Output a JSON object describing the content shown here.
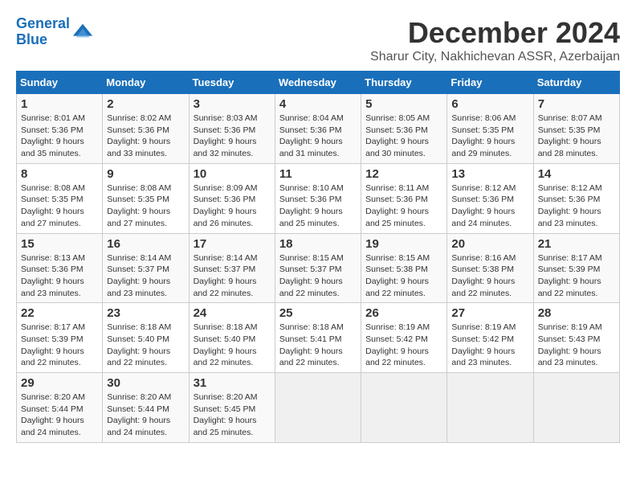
{
  "logo": {
    "line1": "General",
    "line2": "Blue"
  },
  "title": "December 2024",
  "subtitle": "Sharur City, Nakhichevan ASSR, Azerbaijan",
  "header_row": [
    "Sunday",
    "Monday",
    "Tuesday",
    "Wednesday",
    "Thursday",
    "Friday",
    "Saturday"
  ],
  "weeks": [
    [
      {
        "day": "1",
        "sunrise": "Sunrise: 8:01 AM",
        "sunset": "Sunset: 5:36 PM",
        "daylight": "Daylight: 9 hours and 35 minutes."
      },
      {
        "day": "2",
        "sunrise": "Sunrise: 8:02 AM",
        "sunset": "Sunset: 5:36 PM",
        "daylight": "Daylight: 9 hours and 33 minutes."
      },
      {
        "day": "3",
        "sunrise": "Sunrise: 8:03 AM",
        "sunset": "Sunset: 5:36 PM",
        "daylight": "Daylight: 9 hours and 32 minutes."
      },
      {
        "day": "4",
        "sunrise": "Sunrise: 8:04 AM",
        "sunset": "Sunset: 5:36 PM",
        "daylight": "Daylight: 9 hours and 31 minutes."
      },
      {
        "day": "5",
        "sunrise": "Sunrise: 8:05 AM",
        "sunset": "Sunset: 5:36 PM",
        "daylight": "Daylight: 9 hours and 30 minutes."
      },
      {
        "day": "6",
        "sunrise": "Sunrise: 8:06 AM",
        "sunset": "Sunset: 5:35 PM",
        "daylight": "Daylight: 9 hours and 29 minutes."
      },
      {
        "day": "7",
        "sunrise": "Sunrise: 8:07 AM",
        "sunset": "Sunset: 5:35 PM",
        "daylight": "Daylight: 9 hours and 28 minutes."
      }
    ],
    [
      {
        "day": "8",
        "sunrise": "Sunrise: 8:08 AM",
        "sunset": "Sunset: 5:35 PM",
        "daylight": "Daylight: 9 hours and 27 minutes."
      },
      {
        "day": "9",
        "sunrise": "Sunrise: 8:08 AM",
        "sunset": "Sunset: 5:35 PM",
        "daylight": "Daylight: 9 hours and 27 minutes."
      },
      {
        "day": "10",
        "sunrise": "Sunrise: 8:09 AM",
        "sunset": "Sunset: 5:36 PM",
        "daylight": "Daylight: 9 hours and 26 minutes."
      },
      {
        "day": "11",
        "sunrise": "Sunrise: 8:10 AM",
        "sunset": "Sunset: 5:36 PM",
        "daylight": "Daylight: 9 hours and 25 minutes."
      },
      {
        "day": "12",
        "sunrise": "Sunrise: 8:11 AM",
        "sunset": "Sunset: 5:36 PM",
        "daylight": "Daylight: 9 hours and 25 minutes."
      },
      {
        "day": "13",
        "sunrise": "Sunrise: 8:12 AM",
        "sunset": "Sunset: 5:36 PM",
        "daylight": "Daylight: 9 hours and 24 minutes."
      },
      {
        "day": "14",
        "sunrise": "Sunrise: 8:12 AM",
        "sunset": "Sunset: 5:36 PM",
        "daylight": "Daylight: 9 hours and 23 minutes."
      }
    ],
    [
      {
        "day": "15",
        "sunrise": "Sunrise: 8:13 AM",
        "sunset": "Sunset: 5:36 PM",
        "daylight": "Daylight: 9 hours and 23 minutes."
      },
      {
        "day": "16",
        "sunrise": "Sunrise: 8:14 AM",
        "sunset": "Sunset: 5:37 PM",
        "daylight": "Daylight: 9 hours and 23 minutes."
      },
      {
        "day": "17",
        "sunrise": "Sunrise: 8:14 AM",
        "sunset": "Sunset: 5:37 PM",
        "daylight": "Daylight: 9 hours and 22 minutes."
      },
      {
        "day": "18",
        "sunrise": "Sunrise: 8:15 AM",
        "sunset": "Sunset: 5:37 PM",
        "daylight": "Daylight: 9 hours and 22 minutes."
      },
      {
        "day": "19",
        "sunrise": "Sunrise: 8:15 AM",
        "sunset": "Sunset: 5:38 PM",
        "daylight": "Daylight: 9 hours and 22 minutes."
      },
      {
        "day": "20",
        "sunrise": "Sunrise: 8:16 AM",
        "sunset": "Sunset: 5:38 PM",
        "daylight": "Daylight: 9 hours and 22 minutes."
      },
      {
        "day": "21",
        "sunrise": "Sunrise: 8:17 AM",
        "sunset": "Sunset: 5:39 PM",
        "daylight": "Daylight: 9 hours and 22 minutes."
      }
    ],
    [
      {
        "day": "22",
        "sunrise": "Sunrise: 8:17 AM",
        "sunset": "Sunset: 5:39 PM",
        "daylight": "Daylight: 9 hours and 22 minutes."
      },
      {
        "day": "23",
        "sunrise": "Sunrise: 8:18 AM",
        "sunset": "Sunset: 5:40 PM",
        "daylight": "Daylight: 9 hours and 22 minutes."
      },
      {
        "day": "24",
        "sunrise": "Sunrise: 8:18 AM",
        "sunset": "Sunset: 5:40 PM",
        "daylight": "Daylight: 9 hours and 22 minutes."
      },
      {
        "day": "25",
        "sunrise": "Sunrise: 8:18 AM",
        "sunset": "Sunset: 5:41 PM",
        "daylight": "Daylight: 9 hours and 22 minutes."
      },
      {
        "day": "26",
        "sunrise": "Sunrise: 8:19 AM",
        "sunset": "Sunset: 5:42 PM",
        "daylight": "Daylight: 9 hours and 22 minutes."
      },
      {
        "day": "27",
        "sunrise": "Sunrise: 8:19 AM",
        "sunset": "Sunset: 5:42 PM",
        "daylight": "Daylight: 9 hours and 23 minutes."
      },
      {
        "day": "28",
        "sunrise": "Sunrise: 8:19 AM",
        "sunset": "Sunset: 5:43 PM",
        "daylight": "Daylight: 9 hours and 23 minutes."
      }
    ],
    [
      {
        "day": "29",
        "sunrise": "Sunrise: 8:20 AM",
        "sunset": "Sunset: 5:44 PM",
        "daylight": "Daylight: 9 hours and 24 minutes."
      },
      {
        "day": "30",
        "sunrise": "Sunrise: 8:20 AM",
        "sunset": "Sunset: 5:44 PM",
        "daylight": "Daylight: 9 hours and 24 minutes."
      },
      {
        "day": "31",
        "sunrise": "Sunrise: 8:20 AM",
        "sunset": "Sunset: 5:45 PM",
        "daylight": "Daylight: 9 hours and 25 minutes."
      },
      null,
      null,
      null,
      null
    ]
  ]
}
